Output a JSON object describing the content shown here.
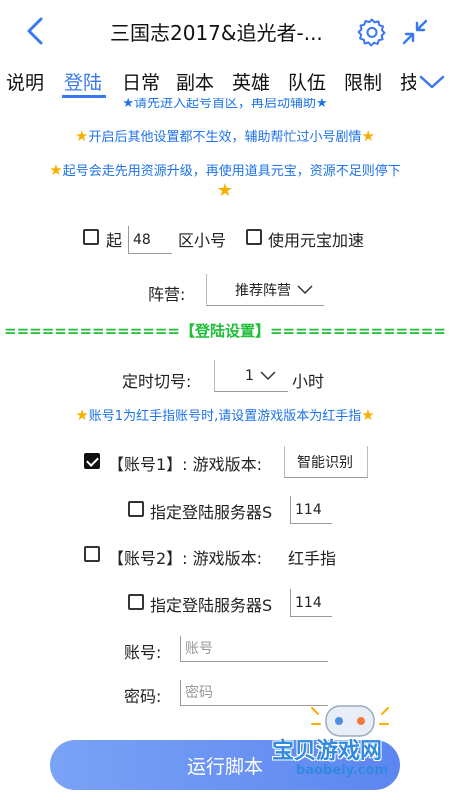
{
  "header": {
    "title": "三国志2017&追光者-..."
  },
  "tabs": [
    {
      "label": "说明"
    },
    {
      "label": "登陆"
    },
    {
      "label": "日常"
    },
    {
      "label": "副本"
    },
    {
      "label": "英雄"
    },
    {
      "label": "队伍"
    },
    {
      "label": "限制"
    },
    {
      "label": "技"
    }
  ],
  "notices": {
    "clipped": "★请先进入起号首区，再启动辅助★",
    "n1": "开启后其他设置都不生效，辅助帮忙过小号剧情",
    "n2": "起号会走先用资源升级，再使用道具元宝，资源不足则停下",
    "account_tip": "账号1为红手指账号时,请设置游戏版本为红手指"
  },
  "start": {
    "label_pre": "起",
    "zone_value": "48",
    "label_post": "区小号",
    "speedup_label": "使用元宝加速",
    "camp_label": "阵营:",
    "camp_value": "推荐阵营"
  },
  "login": {
    "section_title": "==============【登陆设置】==============",
    "timer_label": "定时切号:",
    "timer_value": "1",
    "timer_unit": "小时"
  },
  "account1": {
    "label": "【账号1】: 游戏版本:",
    "version_value": "智能识别",
    "server_label": "指定登陆服务器S",
    "server_value": "114"
  },
  "account2": {
    "label": "【账号2】: 游戏版本:",
    "version_value": "红手指",
    "server_label": "指定登陆服务器S",
    "server_value": "114",
    "account_label": "账号:",
    "account_placeholder": "账号",
    "password_label": "密码:",
    "password_placeholder": "密码"
  },
  "run_button": "运行脚本",
  "watermark": {
    "text": "宝贝游戏网",
    "url": "baobeiy.com"
  },
  "colors": {
    "accent": "#3a78f2",
    "notice": "#1e73e8",
    "star": "#f6b000",
    "section": "#1fbf3a"
  }
}
